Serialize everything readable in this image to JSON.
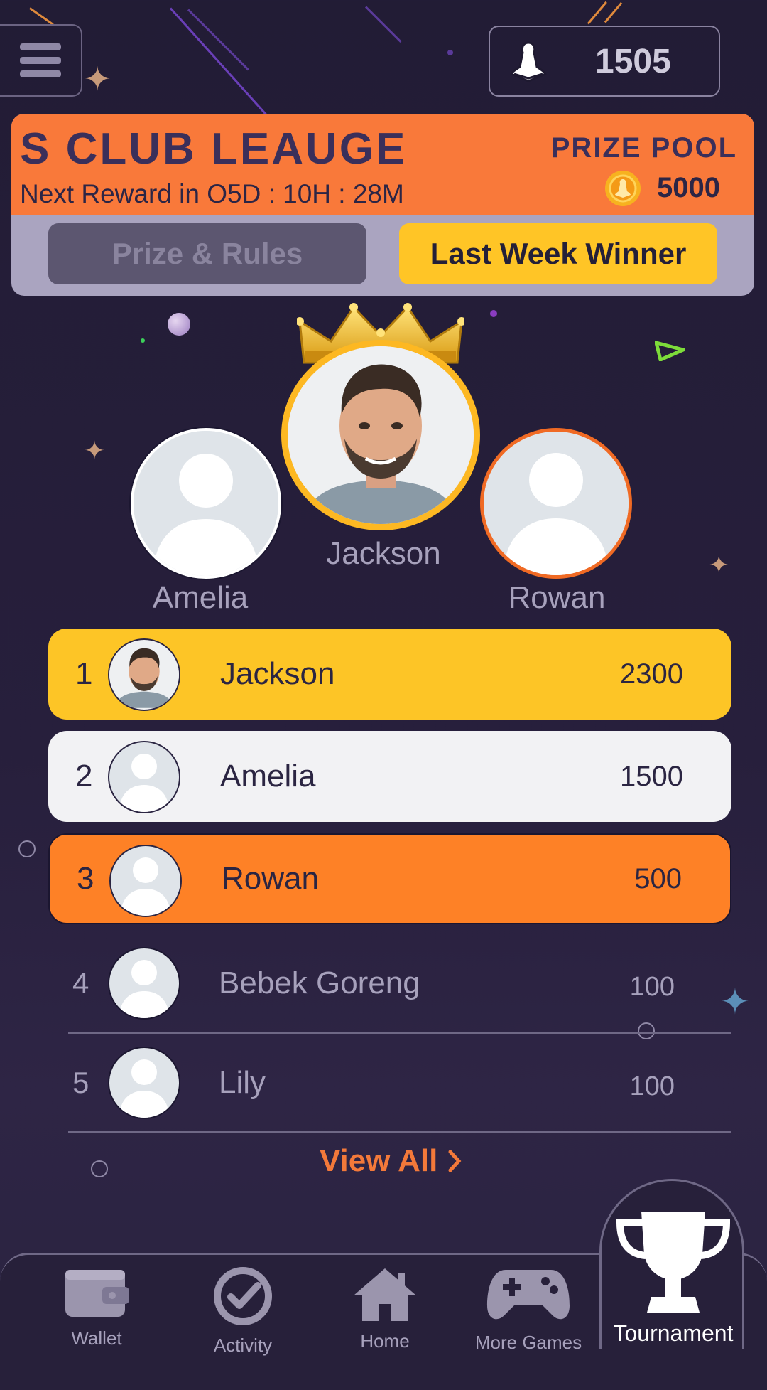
{
  "header": {
    "menu_icon": "hamburger-menu-icon",
    "points_icon": "chess-pawn-coin-icon",
    "points": "1505"
  },
  "league": {
    "title": "S CLUB LEAUGE",
    "next_reward": "Next Reward in O5D : 10H : 28M",
    "prize_pool_label": "PRIZE POOL",
    "prize_pool_value": "5000",
    "accent_color": "#f9793a",
    "tabs": {
      "prize_rules": "Prize & Rules",
      "last_week_winner": "Last Week Winner"
    }
  },
  "podium": {
    "first": {
      "name": "Jackson"
    },
    "second": {
      "name": "Amelia"
    },
    "third": {
      "name": "Rowan"
    }
  },
  "leaderboard": [
    {
      "rank": "1",
      "name": "Jackson",
      "score": "2300"
    },
    {
      "rank": "2",
      "name": "Amelia",
      "score": "1500"
    },
    {
      "rank": "3",
      "name": "Rowan",
      "score": "500"
    },
    {
      "rank": "4",
      "name": "Bebek Goreng",
      "score": "100"
    },
    {
      "rank": "5",
      "name": "Lily",
      "score": "100"
    }
  ],
  "view_all": "View All",
  "nav": {
    "wallet": "Wallet",
    "activity": "Activity",
    "home": "Home",
    "more_games": "More Games",
    "tournament": "Tournament"
  },
  "colors": {
    "gold": "#fdc526",
    "silver": "#f2f2f4",
    "bronze": "#fe8126",
    "background": "#221c35"
  }
}
